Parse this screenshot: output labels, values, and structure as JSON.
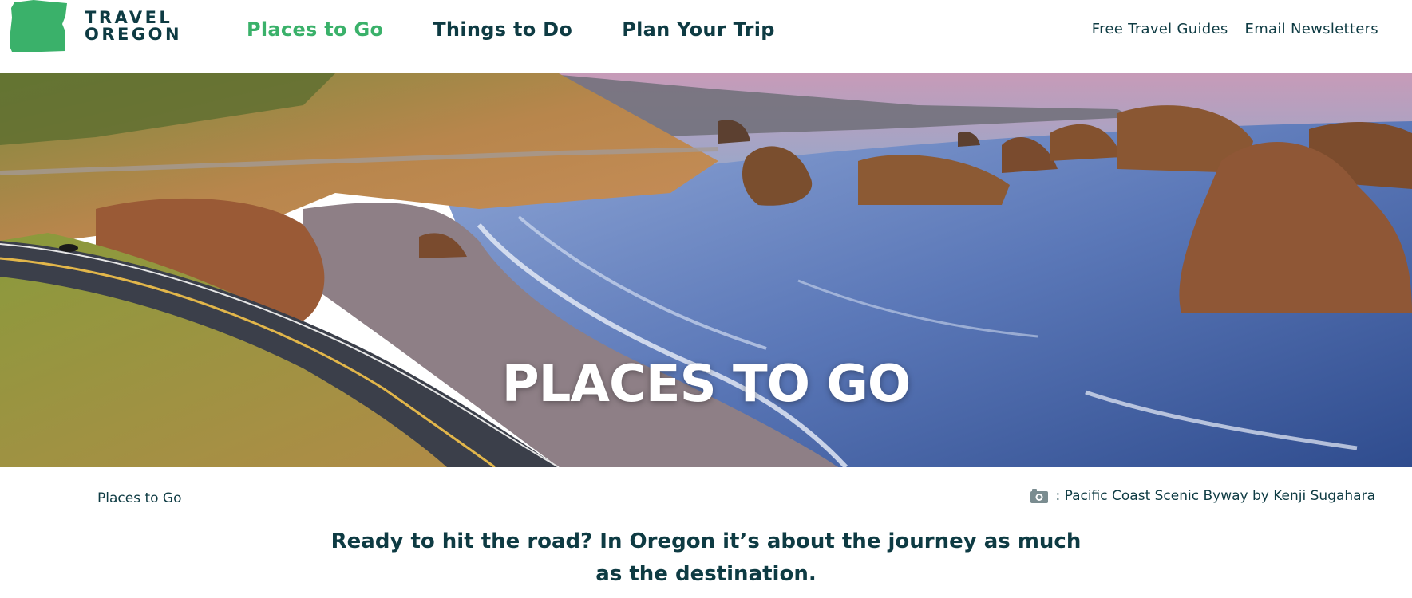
{
  "brand": {
    "line1": "TRAVEL",
    "line2": "OREGON",
    "logo_color": "#3ab16a",
    "text_color": "#0e3b43"
  },
  "main_nav": [
    {
      "label": "Places to Go",
      "active": true
    },
    {
      "label": "Things to Do",
      "active": false
    },
    {
      "label": "Plan Your Trip",
      "active": false
    }
  ],
  "utility_nav": [
    {
      "label": "Free Travel Guides"
    },
    {
      "label": "Email Newsletters"
    }
  ],
  "hero": {
    "title": "PLACES TO GO"
  },
  "breadcrumb": {
    "label": "Places to Go"
  },
  "photo_credit": {
    "icon": "camera-icon",
    "text": ": Pacific Coast Scenic Byway by Kenji Sugahara"
  },
  "intro": {
    "text": "Ready to hit the road? In Oregon it’s about the journey as much as the destination."
  },
  "colors": {
    "accent_green": "#3ab16a",
    "dark_teal": "#0e3b43"
  }
}
